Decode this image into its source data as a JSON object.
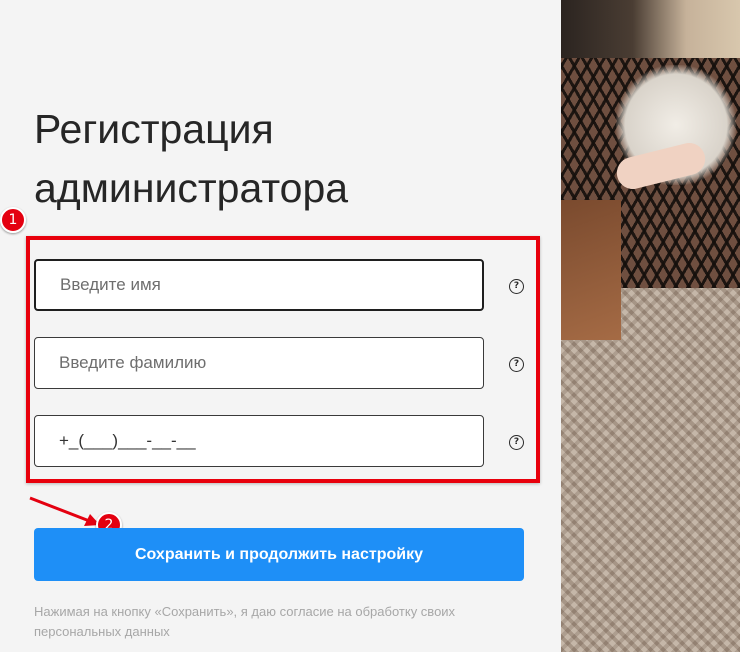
{
  "title": {
    "line1": "Регистрация",
    "line2": "администратора"
  },
  "form": {
    "first_name": {
      "placeholder": "Введите имя",
      "value": ""
    },
    "last_name": {
      "placeholder": "Введите фамилию",
      "value": ""
    },
    "phone": {
      "placeholder": "",
      "value": "+_(___)___-__-__"
    },
    "help_symbol": "?"
  },
  "save_button": {
    "label": "Сохранить и продолжить настройку"
  },
  "consent_text": "Нажимая на кнопку «Сохранить», я даю согласие на обработку своих персональных данных",
  "annotations": {
    "badge1": "1",
    "badge2": "2",
    "color": "#e8000c"
  },
  "colors": {
    "primary_button": "#1e8ff7",
    "background": "#f4f4f4"
  }
}
